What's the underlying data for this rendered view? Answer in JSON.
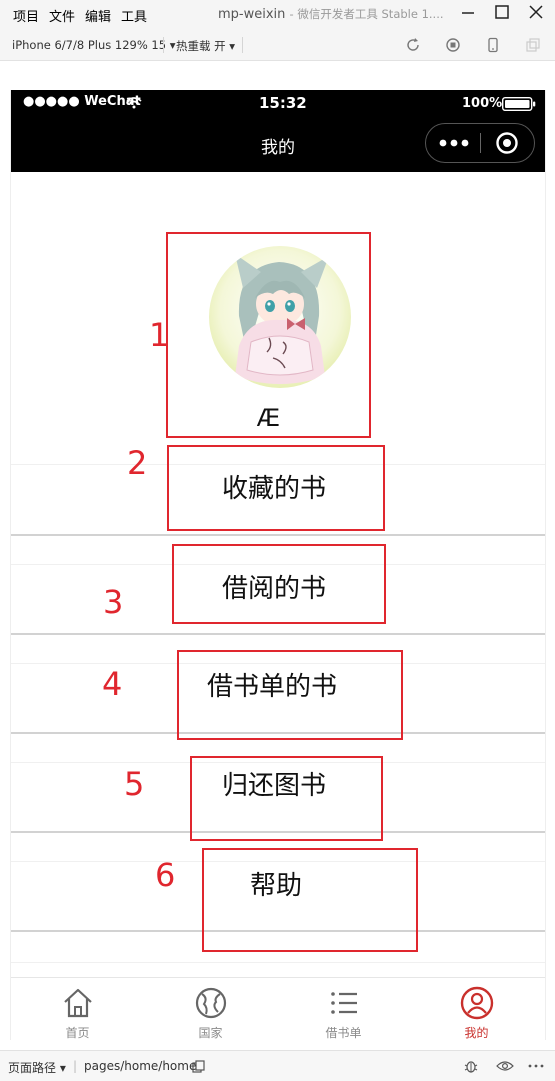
{
  "window": {
    "menus": [
      "项目",
      "文件",
      "编辑",
      "工具"
    ],
    "title": "mp-weixin",
    "title_sub": "- 微信开发者工具 Stable 1...."
  },
  "toolbar": {
    "device": "iPhone 6/7/8 Plus 129% 15 ▾",
    "hot_reload": "热重载 开 ▾"
  },
  "status": {
    "carrier": "●●●●● WeChat",
    "time": "15:32",
    "battery": "100%"
  },
  "nav": {
    "title": "我的"
  },
  "profile": {
    "username": "Æ"
  },
  "menu_items": [
    {
      "label": "收藏的书"
    },
    {
      "label": "借阅的书"
    },
    {
      "label": "借书单的书"
    },
    {
      "label": "归还图书"
    },
    {
      "label": "帮助"
    }
  ],
  "annotations": [
    "1",
    "2",
    "3",
    "4",
    "5",
    "6"
  ],
  "tabs": [
    {
      "label": "首页",
      "icon": "home-icon"
    },
    {
      "label": "国家",
      "icon": "globe-icon"
    },
    {
      "label": "借书单",
      "icon": "list-icon"
    },
    {
      "label": "我的",
      "icon": "user-icon",
      "active": true
    }
  ],
  "colors": {
    "accent_red": "#e0262e",
    "tab_active": "#c9302c",
    "nav_bg": "#000000"
  },
  "bottombar": {
    "path_label": "页面路径 ▾",
    "path": "pages/home/home"
  }
}
